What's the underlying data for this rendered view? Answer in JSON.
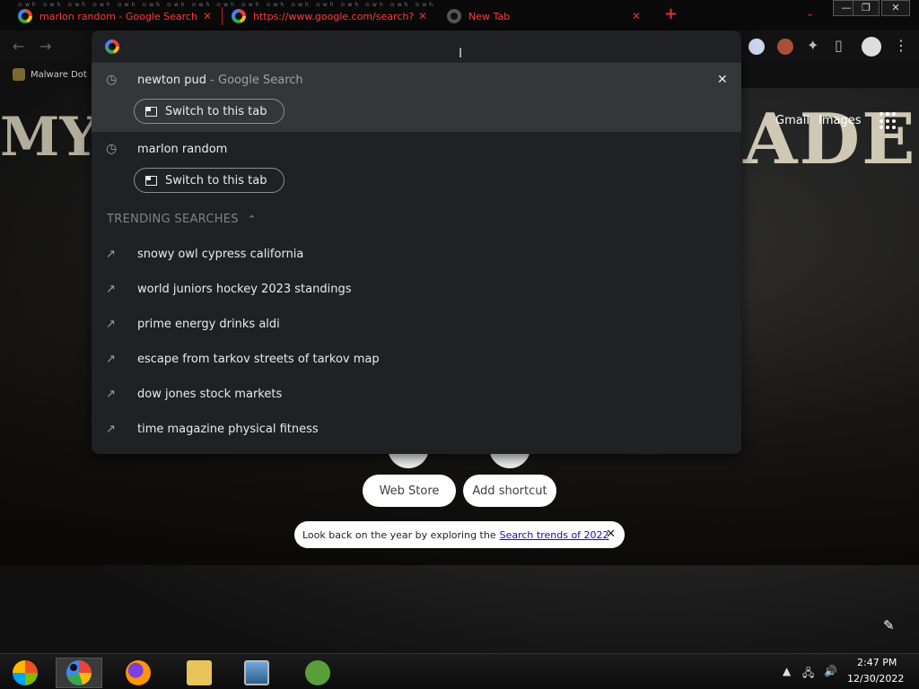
{
  "browser": {
    "tabs": [
      {
        "title": "marlon random - Google Search",
        "favicon": "google-icon"
      },
      {
        "title": "https://www.google.com/search?",
        "favicon": "google-icon"
      },
      {
        "title": "New Tab",
        "favicon": "chrome-icon"
      }
    ],
    "new_tab_glyph": "+",
    "tab_close_glyph": "✕",
    "window_controls": {
      "minimize": "—",
      "maximize": "❐",
      "close": "✕"
    },
    "bookmark": {
      "label": "Malware Dot"
    }
  },
  "omnibox": {
    "history": [
      {
        "query": "newton pud",
        "suffix": " - Google Search",
        "switch_label": "Switch to this tab"
      },
      {
        "query": "marlon random",
        "suffix": "",
        "switch_label": "Switch to this tab"
      }
    ],
    "trending_header": "TRENDING SEARCHES",
    "trending": [
      "snowy owl cypress california",
      "world juniors hockey 2023 standings",
      "prime energy drinks aldi",
      "escape from tarkov streets of tarkov map",
      "dow jones stock markets",
      "time magazine physical fitness"
    ]
  },
  "page": {
    "gmail": "Gmail",
    "images": "Images",
    "logo_right": "ADE",
    "web_store": "Web Store",
    "add_shortcut": "Add shortcut",
    "promo_text": "Look back on the year by exploring the",
    "promo_link": "Search trends of 2022"
  },
  "taskbar": {
    "time": "2:47 PM",
    "date": "12/30/2022"
  },
  "colors": {
    "tab_text": "#ff3b3b",
    "omnibox_bg": "#202124",
    "highlight_bg": "#35363a",
    "link": "#1a0dab"
  }
}
